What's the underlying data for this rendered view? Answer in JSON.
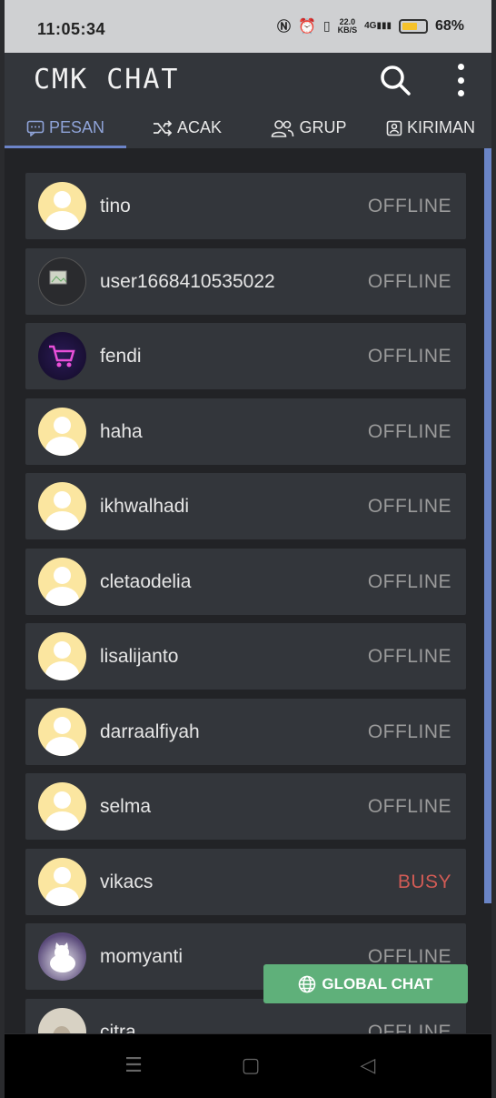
{
  "statusbar": {
    "time": "11:05:34",
    "speed_value": "22.0",
    "speed_unit": "KB/S",
    "network": "4G",
    "battery": "68%",
    "battery_level": 0.68
  },
  "app": {
    "title": "CMK CHAT"
  },
  "tabs": [
    {
      "label": "PESAN",
      "icon": "message-icon",
      "active": true
    },
    {
      "label": "ACAK",
      "icon": "shuffle-icon",
      "active": false
    },
    {
      "label": "GRUP",
      "icon": "group-icon",
      "active": false
    },
    {
      "label": "KIRIMAN",
      "icon": "post-icon",
      "active": false
    }
  ],
  "contacts": [
    {
      "name": "tino",
      "status": "OFFLINE",
      "avatar": "default-avatar"
    },
    {
      "name": "user1668410535022",
      "status": "OFFLINE",
      "avatar": "broken-image"
    },
    {
      "name": "fendi",
      "status": "OFFLINE",
      "avatar": "shopping-cart"
    },
    {
      "name": "haha",
      "status": "OFFLINE",
      "avatar": "default-avatar"
    },
    {
      "name": "ikhwalhadi",
      "status": "OFFLINE",
      "avatar": "default-avatar"
    },
    {
      "name": "cletaodelia",
      "status": "OFFLINE",
      "avatar": "default-avatar"
    },
    {
      "name": "lisalijanto",
      "status": "OFFLINE",
      "avatar": "default-avatar"
    },
    {
      "name": "darraalfiyah",
      "status": "OFFLINE",
      "avatar": "default-avatar"
    },
    {
      "name": "selma",
      "status": "OFFLINE",
      "avatar": "default-avatar"
    },
    {
      "name": "vikacs",
      "status": "BUSY",
      "avatar": "default-avatar"
    },
    {
      "name": "momyanti",
      "status": "OFFLINE",
      "avatar": "cat-photo"
    },
    {
      "name": "citra",
      "status": "OFFLINE",
      "avatar": "photo"
    }
  ],
  "global_chat": {
    "label": "GLOBAL CHAT",
    "icon": "globe-icon"
  },
  "colors": {
    "busy": "#d05b55",
    "offline": "#9a9a9a",
    "accent": "#6c84c9",
    "global": "#5fb07a",
    "avatar": "#fbe6a0"
  }
}
